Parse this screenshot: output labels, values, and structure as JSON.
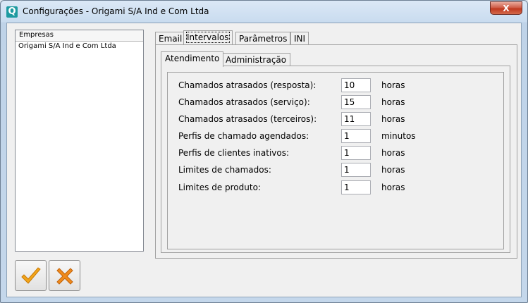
{
  "window": {
    "title": "Configurações - Origami S/A Ind e Com Ltda",
    "icon_letter": "Q",
    "close_label": "X"
  },
  "empresas": {
    "header": "Empresas",
    "items": [
      "Origami S/A Ind e Com Ltda"
    ]
  },
  "tabs": [
    {
      "label": "Email",
      "active": false
    },
    {
      "label": "Intervalos",
      "active": true
    },
    {
      "label": "Parâmetros",
      "active": false
    },
    {
      "label": "INI",
      "active": false
    }
  ],
  "subtabs": [
    {
      "label": "Atendimento",
      "active": true
    },
    {
      "label": "Administração",
      "active": false
    }
  ],
  "fields": [
    {
      "label": "Chamados atrasados (resposta):",
      "value": "10",
      "unit": "horas"
    },
    {
      "label": "Chamados atrasados (serviço):",
      "value": "15",
      "unit": "horas"
    },
    {
      "label": "Chamados atrasados (terceiros):",
      "value": "11",
      "unit": "horas"
    },
    {
      "label": "Perfis de chamado agendados:",
      "value": "1",
      "unit": "minutos"
    },
    {
      "label": "Perfis de clientes inativos:",
      "value": "1",
      "unit": "horas"
    },
    {
      "label": "Limites de chamados:",
      "value": "1",
      "unit": "horas"
    },
    {
      "label": "Limites de produto:",
      "value": "1",
      "unit": "horas"
    }
  ],
  "buttons": {
    "ok_icon": "checkmark-icon",
    "cancel_icon": "x-cross-icon"
  },
  "colors": {
    "close": "#c0391f",
    "check": "#f2a51a",
    "cross": "#f08a1c"
  }
}
